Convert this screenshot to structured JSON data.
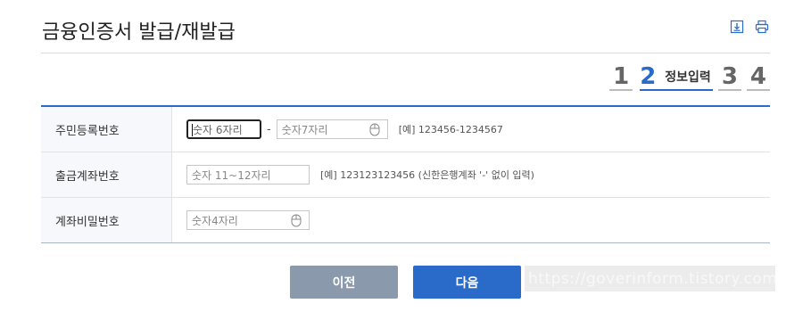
{
  "header": {
    "title": "금융인증서 발급/재발급",
    "tools": [
      {
        "icon": "download-icon"
      },
      {
        "icon": "print-icon"
      }
    ]
  },
  "steps": {
    "items": [
      "1",
      "2",
      "3",
      "4"
    ],
    "active_index": 1,
    "active_label": "정보입력"
  },
  "form": {
    "rows": [
      {
        "label": "주민등록번호",
        "fields": [
          {
            "placeholder": "숫자 6자리",
            "focused": true
          },
          {
            "placeholder": "숫자7자리",
            "icon": "mouse-icon"
          }
        ],
        "separator": "-",
        "hint": "[예] 123456-1234567"
      },
      {
        "label": "출금계좌번호",
        "fields": [
          {
            "placeholder": "숫자 11~12자리"
          }
        ],
        "hint": "[예] 123123123456 (신한은행계좌 '-' 없이 입력)"
      },
      {
        "label": "계좌비밀번호",
        "fields": [
          {
            "placeholder": "숫자4자리",
            "icon": "mouse-icon"
          }
        ]
      }
    ]
  },
  "buttons": {
    "prev_label": "이전",
    "next_label": "다음"
  },
  "watermark": "https://goverinform.tistory.com",
  "colors": {
    "accent": "#2a6ac8",
    "prev_button": "#8a99ab",
    "label_bg": "#f6f8fb"
  }
}
